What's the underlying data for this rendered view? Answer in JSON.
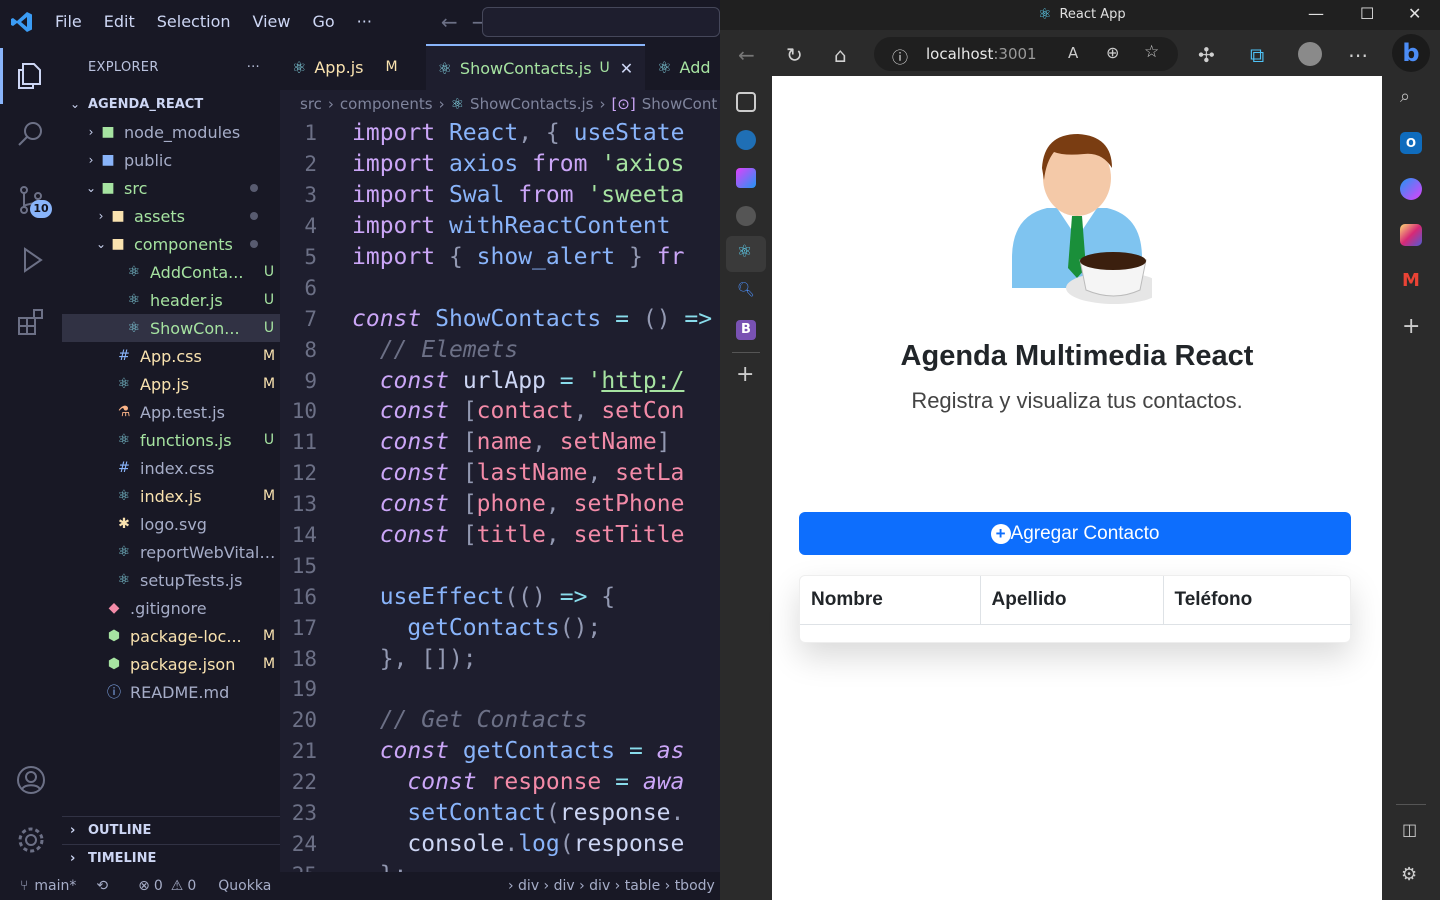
{
  "vscode": {
    "menu": [
      "File",
      "Edit",
      "Selection",
      "View",
      "Go"
    ],
    "more": "···",
    "explorer_title": "EXPLORER",
    "explorer_more": "···",
    "scm_badge": "10",
    "root_folder": "AGENDA_REACT",
    "tree": [
      {
        "label": "node_modules",
        "status": ""
      },
      {
        "label": "public",
        "status": ""
      },
      {
        "label": "src",
        "status": "dot"
      },
      {
        "label": "assets",
        "status": "dot"
      },
      {
        "label": "components",
        "status": "dot"
      },
      {
        "label": "AddConta...",
        "status": "U"
      },
      {
        "label": "header.js",
        "status": "U"
      },
      {
        "label": "ShowCon...",
        "status": "U"
      },
      {
        "label": "App.css",
        "status": "M"
      },
      {
        "label": "App.js",
        "status": "M"
      },
      {
        "label": "App.test.js",
        "status": ""
      },
      {
        "label": "functions.js",
        "status": "U"
      },
      {
        "label": "index.css",
        "status": ""
      },
      {
        "label": "index.js",
        "status": "M"
      },
      {
        "label": "logo.svg",
        "status": ""
      },
      {
        "label": "reportWebVitals.js",
        "status": ""
      },
      {
        "label": "setupTests.js",
        "status": ""
      },
      {
        "label": ".gitignore",
        "status": ""
      },
      {
        "label": "package-loc...",
        "status": "M"
      },
      {
        "label": "package.json",
        "status": "M"
      },
      {
        "label": "README.md",
        "status": ""
      }
    ],
    "outline": "OUTLINE",
    "timeline": "TIMELINE",
    "tabs": [
      {
        "label": "App.js",
        "mark": "M"
      },
      {
        "label": "ShowContacts.js",
        "mark": "U"
      },
      {
        "label": "Add",
        "mark": ""
      }
    ],
    "breadcrumb": [
      "src",
      "components",
      "ShowContacts.js",
      "ShowCont"
    ],
    "status": {
      "branch": "main*",
      "problems": "0",
      "warnings": "0",
      "quokka": "Quokka",
      "path": "› div › div › div › table › tbody"
    }
  },
  "edge": {
    "title": "React App",
    "url_host": "localhost",
    "url_port": ":3001",
    "page": {
      "title": "Agenda Multimedia React",
      "subtitle": "Registra y visualiza tus contactos.",
      "add_button": "Agregar Contacto",
      "columns": [
        "Nombre",
        "Apellido",
        "Teléfono"
      ]
    }
  },
  "colors": {
    "primary_button": "#0d6efd",
    "editor_bg": "#1e1e2e",
    "accent": "#89b4fa"
  }
}
